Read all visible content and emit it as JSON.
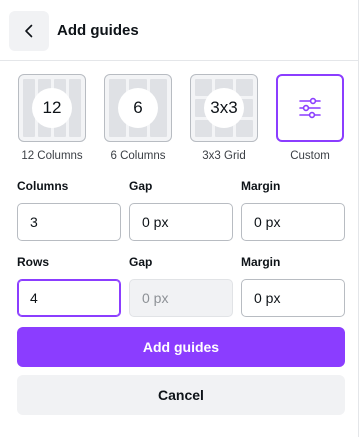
{
  "header": {
    "title": "Add guides"
  },
  "presets": [
    {
      "badge": "12",
      "label": "12 Columns"
    },
    {
      "badge": "6",
      "label": "6 Columns"
    },
    {
      "badge": "3x3",
      "label": "3x3 Grid"
    },
    {
      "label": "Custom",
      "selected": true
    }
  ],
  "columns_row": {
    "columns_label": "Columns",
    "columns_value": "3",
    "gap_label": "Gap",
    "gap_value": "0 px",
    "margin_label": "Margin",
    "margin_value": "0 px"
  },
  "rows_row": {
    "rows_label": "Rows",
    "rows_value": "4",
    "gap_label": "Gap",
    "gap_placeholder": "0 px",
    "margin_label": "Margin",
    "margin_value": "0 px"
  },
  "actions": {
    "add_label": "Add guides",
    "cancel_label": "Cancel"
  },
  "colors": {
    "accent": "#8b3dff",
    "button_gray": "#f1f2f4"
  }
}
